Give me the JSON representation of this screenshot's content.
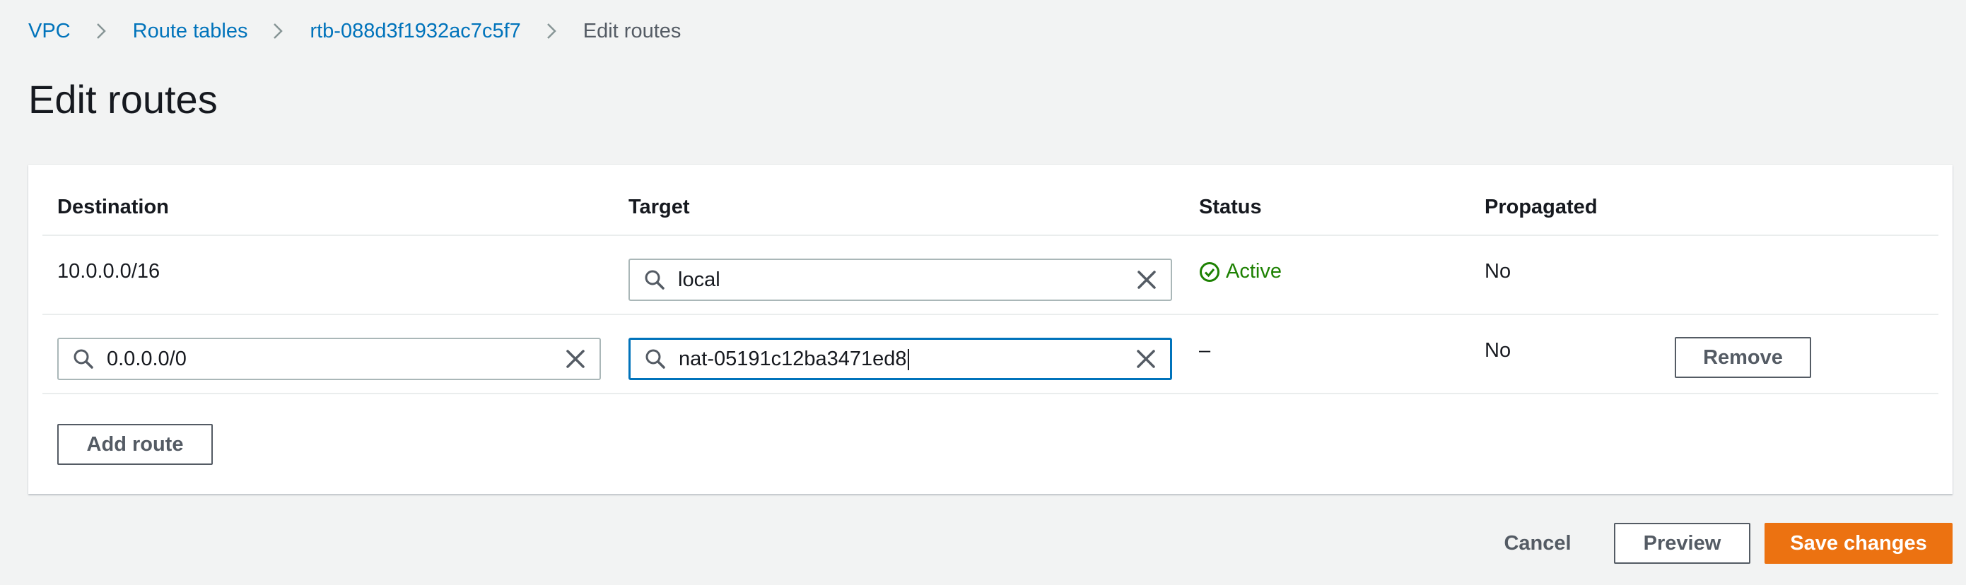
{
  "breadcrumb": {
    "items": [
      "VPC",
      "Route tables",
      "rtb-088d3f1932ac7c5f7",
      "Edit routes"
    ]
  },
  "page_title": "Edit routes",
  "table": {
    "headers": [
      "Destination",
      "Target",
      "Status",
      "Propagated"
    ],
    "rows": [
      {
        "destination": "10.0.0.0/16",
        "target": "local",
        "status": "Active",
        "propagated": "No"
      },
      {
        "destination": "0.0.0.0/0",
        "target": "nat-05191c12ba3471ed8",
        "status": "–",
        "propagated": "No",
        "remove_label": "Remove"
      }
    ]
  },
  "add_route_label": "Add route",
  "footer": {
    "cancel_label": "Cancel",
    "preview_label": "Preview",
    "save_label": "Save changes"
  },
  "icons": {
    "chevron": "chevron-right-icon",
    "search": "search-icon",
    "clear": "close-icon",
    "status": "check-circle-icon"
  },
  "colors": {
    "link": "#0073bb",
    "success": "#1d8102",
    "primary": "#ec7211",
    "focus": "#0073bb"
  }
}
